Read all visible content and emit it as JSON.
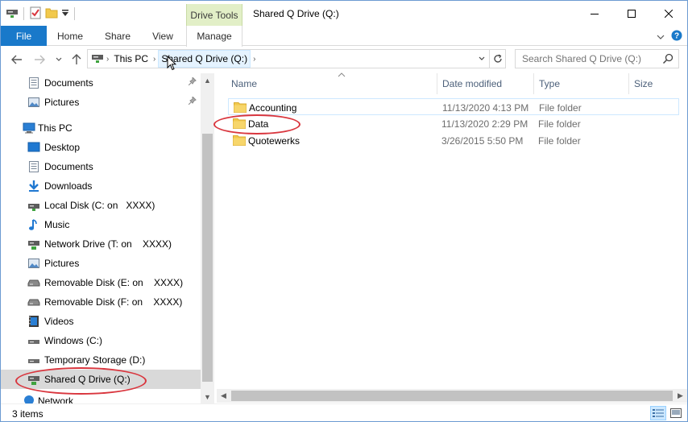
{
  "window": {
    "title": "Shared Q Drive (Q:)",
    "context_group": "Drive Tools"
  },
  "ribbon": {
    "tabs": [
      "File",
      "Home",
      "Share",
      "View",
      "Manage"
    ]
  },
  "address": {
    "crumbs": [
      "This PC",
      "Shared Q Drive (Q:)"
    ]
  },
  "search": {
    "placeholder": "Search Shared Q Drive (Q:)"
  },
  "nav": {
    "quick_access": [
      {
        "label": "Documents",
        "icon": "documents-icon",
        "pinned": true
      },
      {
        "label": "Pictures",
        "icon": "pictures-icon",
        "pinned": true
      }
    ],
    "this_pc": "This PC",
    "items": [
      {
        "label": "Desktop",
        "icon": "desktop-icon"
      },
      {
        "label": "Documents",
        "icon": "documents-icon"
      },
      {
        "label": "Downloads",
        "icon": "downloads-icon"
      },
      {
        "label": "Local Disk (C: on   XXXX)",
        "icon": "local-disk-icon"
      },
      {
        "label": "Music",
        "icon": "music-icon"
      },
      {
        "label": "Network Drive (T: on    XXXX)",
        "icon": "network-drive-icon"
      },
      {
        "label": "Pictures",
        "icon": "pictures-icon"
      },
      {
        "label": "Removable Disk (E: on    XXXX)",
        "icon": "removable-disk-icon"
      },
      {
        "label": "Removable Disk (F: on    XXXX)",
        "icon": "removable-disk-icon"
      },
      {
        "label": "Videos",
        "icon": "videos-icon"
      },
      {
        "label": "Windows (C:)",
        "icon": "windows-drive-icon"
      },
      {
        "label": "Temporary Storage (D:)",
        "icon": "temp-drive-icon"
      },
      {
        "label": "Shared Q Drive (Q:)",
        "icon": "network-drive-icon",
        "selected": true
      }
    ],
    "partial_bottom": "Network"
  },
  "columns": [
    "Name",
    "Date modified",
    "Type",
    "Size"
  ],
  "files": [
    {
      "name": "Accounting",
      "date": "11/13/2020 4:13 PM",
      "type": "File folder"
    },
    {
      "name": "Data",
      "date": "11/13/2020 2:29 PM",
      "type": "File folder"
    },
    {
      "name": "Quotewerks",
      "date": "3/26/2015 5:50 PM",
      "type": "File folder"
    }
  ],
  "status": {
    "count": "3 items"
  },
  "colors": {
    "accent": "#1979ca",
    "context_tab": "#e2efc7",
    "annotation": "#d9363e",
    "folder": "#f2c94c"
  }
}
